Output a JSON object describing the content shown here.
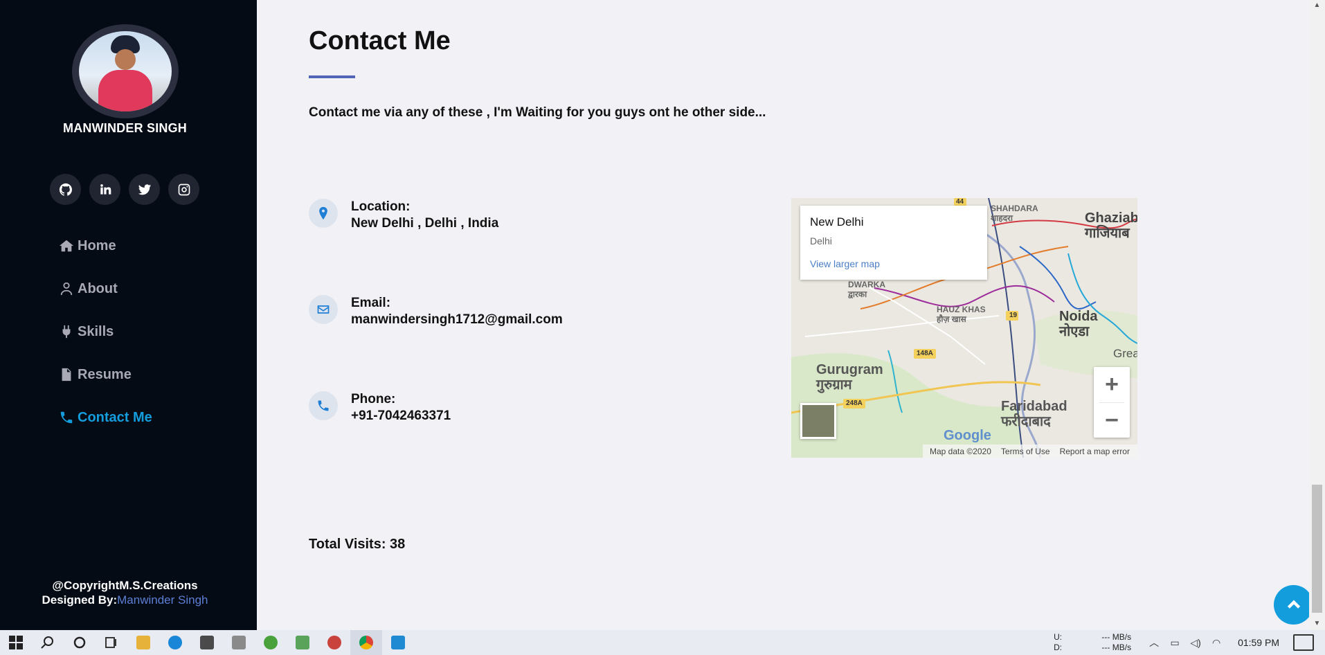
{
  "sidebar": {
    "profile_name": "MANWINDER SINGH",
    "social": [
      {
        "name": "github",
        "icon": "github-icon"
      },
      {
        "name": "linkedin",
        "icon": "linkedin-icon"
      },
      {
        "name": "twitter",
        "icon": "twitter-icon"
      },
      {
        "name": "instagram",
        "icon": "instagram-icon"
      }
    ],
    "nav": [
      {
        "label": "Home",
        "icon": "home-icon"
      },
      {
        "label": "About",
        "icon": "user-icon"
      },
      {
        "label": "Skills",
        "icon": "plug-icon"
      },
      {
        "label": "Resume",
        "icon": "file-icon"
      },
      {
        "label": "Contact Me",
        "icon": "phone-icon",
        "active": true
      }
    ],
    "footer": {
      "copyright": "@CopyrightM.S.Creations",
      "designed_by": "Designed By:",
      "designer": "Manwinder Singh"
    }
  },
  "main": {
    "title": "Contact Me",
    "intro": "Contact me via any of these , I'm Waiting for you guys ont he other side...",
    "contacts": [
      {
        "label": "Location:",
        "value": "New Delhi , Delhi , India",
        "icon": "location-pin-icon"
      },
      {
        "label": "Email:",
        "value": "manwindersingh1712@gmail.com",
        "icon": "envelope-icon"
      },
      {
        "label": "Phone:",
        "value": "+91-7042463371",
        "icon": "phone-icon"
      }
    ],
    "map": {
      "popup_title": "New Delhi",
      "popup_sub": "Delhi",
      "popup_link": "View larger map",
      "labels": [
        "Ghaziab",
        "गाजियाब",
        "Noida",
        "नोएडा",
        "Gurugram",
        "गुरुग्राम",
        "Faridabad",
        "फरीदाबाद",
        "SHAHDARA",
        "शाहदरा",
        "DWARKA",
        "द्वारका",
        "HAUZ KHAS",
        "हौज़ खास",
        "Great",
        "44",
        "19",
        "148A",
        "248A"
      ],
      "zoom_in": "+",
      "zoom_out": "−",
      "brand": "Google",
      "attribution": "Map data ©2020",
      "terms": "Terms of Use",
      "report": "Report a map error"
    },
    "visits_label": "Total Visits: 38"
  },
  "taskbar": {
    "net_up_label": "U:",
    "net_down_label": "D:",
    "net_up": "--- MB/s",
    "net_down": "--- MB/s",
    "time": "01:59 PM"
  },
  "colors": {
    "sidebar_bg": "#040b14",
    "accent": "#149ddd",
    "title_underline": "#5264b7",
    "main_bg": "#f2f1f6"
  }
}
